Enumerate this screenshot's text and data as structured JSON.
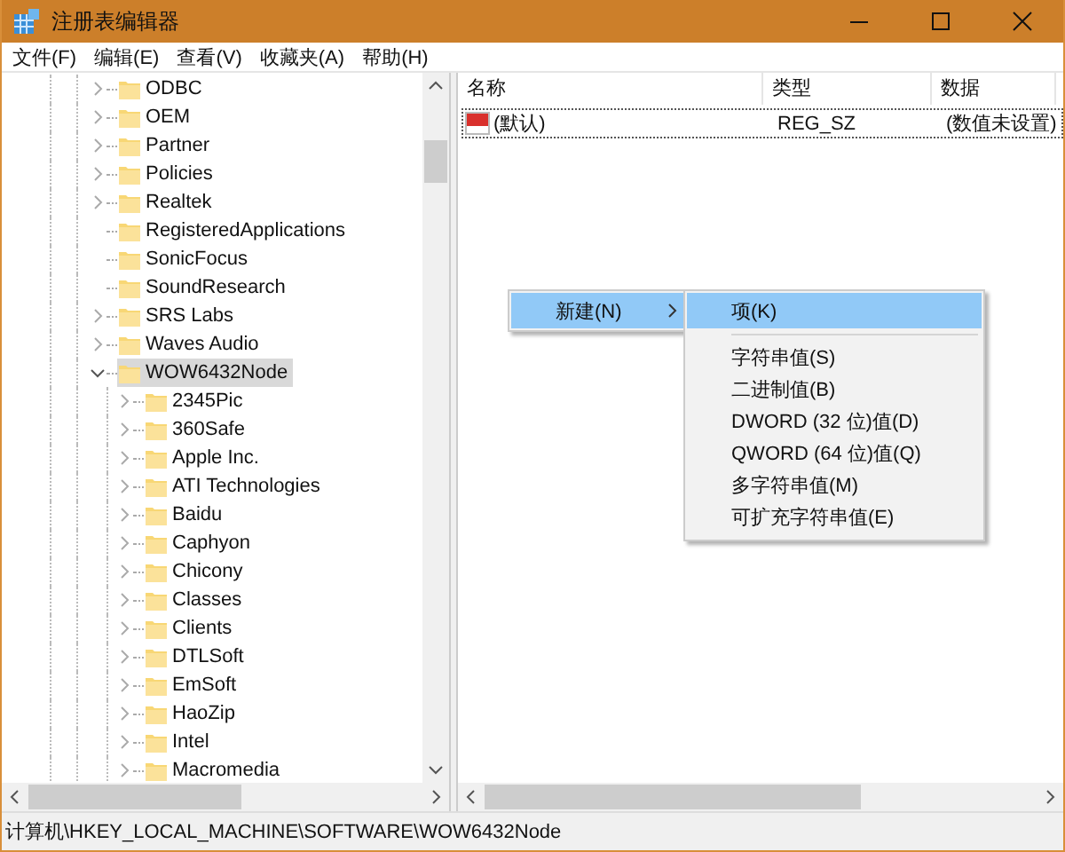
{
  "window": {
    "title": "注册表编辑器"
  },
  "menu_bar": [
    "文件(F)",
    "编辑(E)",
    "查看(V)",
    "收藏夹(A)",
    "帮助(H)"
  ],
  "tree": {
    "items": [
      {
        "label": "ODBC",
        "has_children": true,
        "expanded": false,
        "selected": false
      },
      {
        "label": "OEM",
        "has_children": true,
        "expanded": false,
        "selected": false
      },
      {
        "label": "Partner",
        "has_children": true,
        "expanded": false,
        "selected": false
      },
      {
        "label": "Policies",
        "has_children": true,
        "expanded": false,
        "selected": false
      },
      {
        "label": "Realtek",
        "has_children": true,
        "expanded": false,
        "selected": false
      },
      {
        "label": "RegisteredApplications",
        "has_children": false,
        "selected": false
      },
      {
        "label": "SonicFocus",
        "has_children": false,
        "selected": false
      },
      {
        "label": "SoundResearch",
        "has_children": false,
        "selected": false
      },
      {
        "label": "SRS Labs",
        "has_children": true,
        "expanded": false,
        "selected": false
      },
      {
        "label": "Waves Audio",
        "has_children": true,
        "expanded": false,
        "selected": false
      },
      {
        "label": "WOW6432Node",
        "has_children": true,
        "expanded": true,
        "selected": true,
        "children": [
          {
            "label": "2345Pic",
            "has_children": true,
            "expanded": false,
            "selected": false
          },
          {
            "label": "360Safe",
            "has_children": true,
            "expanded": false,
            "selected": false
          },
          {
            "label": "Apple Inc.",
            "has_children": true,
            "expanded": false,
            "selected": false
          },
          {
            "label": "ATI Technologies",
            "has_children": true,
            "expanded": false,
            "selected": false
          },
          {
            "label": "Baidu",
            "has_children": true,
            "expanded": false,
            "selected": false
          },
          {
            "label": "Caphyon",
            "has_children": true,
            "expanded": false,
            "selected": false
          },
          {
            "label": "Chicony",
            "has_children": true,
            "expanded": false,
            "selected": false
          },
          {
            "label": "Classes",
            "has_children": true,
            "expanded": false,
            "selected": false
          },
          {
            "label": "Clients",
            "has_children": true,
            "expanded": false,
            "selected": false
          },
          {
            "label": "DTLSoft",
            "has_children": true,
            "expanded": false,
            "selected": false
          },
          {
            "label": "EmSoft",
            "has_children": true,
            "expanded": false,
            "selected": false
          },
          {
            "label": "HaoZip",
            "has_children": true,
            "expanded": false,
            "selected": false
          },
          {
            "label": "Intel",
            "has_children": true,
            "expanded": false,
            "selected": false
          },
          {
            "label": "Macromedia",
            "has_children": true,
            "expanded": false,
            "selected": false
          }
        ]
      }
    ]
  },
  "values_list": {
    "columns": [
      "名称",
      "类型",
      "数据"
    ],
    "rows": [
      {
        "name": "(默认)",
        "type": "REG_SZ",
        "data": "(数值未设置)",
        "selected": true
      }
    ]
  },
  "context_menu": {
    "items": [
      {
        "label": "新建(N)",
        "kind": "submenu",
        "selected": true
      }
    ]
  },
  "submenu": {
    "items": [
      {
        "kind": "item",
        "label": "项(K)",
        "selected": true
      },
      {
        "kind": "separator"
      },
      {
        "kind": "item",
        "label": "字符串值(S)",
        "selected": false
      },
      {
        "kind": "item",
        "label": "二进制值(B)",
        "selected": false
      },
      {
        "kind": "item",
        "label": "DWORD (32 位)值(D)",
        "selected": false
      },
      {
        "kind": "item",
        "label": "QWORD (64 位)值(Q)",
        "selected": false
      },
      {
        "kind": "item",
        "label": "多字符串值(M)",
        "selected": false
      },
      {
        "kind": "item",
        "label": "可扩充字符串值(E)",
        "selected": false
      }
    ]
  },
  "status_bar": "计算机\\HKEY_LOCAL_MACHINE\\SOFTWARE\\WOW6432Node"
}
